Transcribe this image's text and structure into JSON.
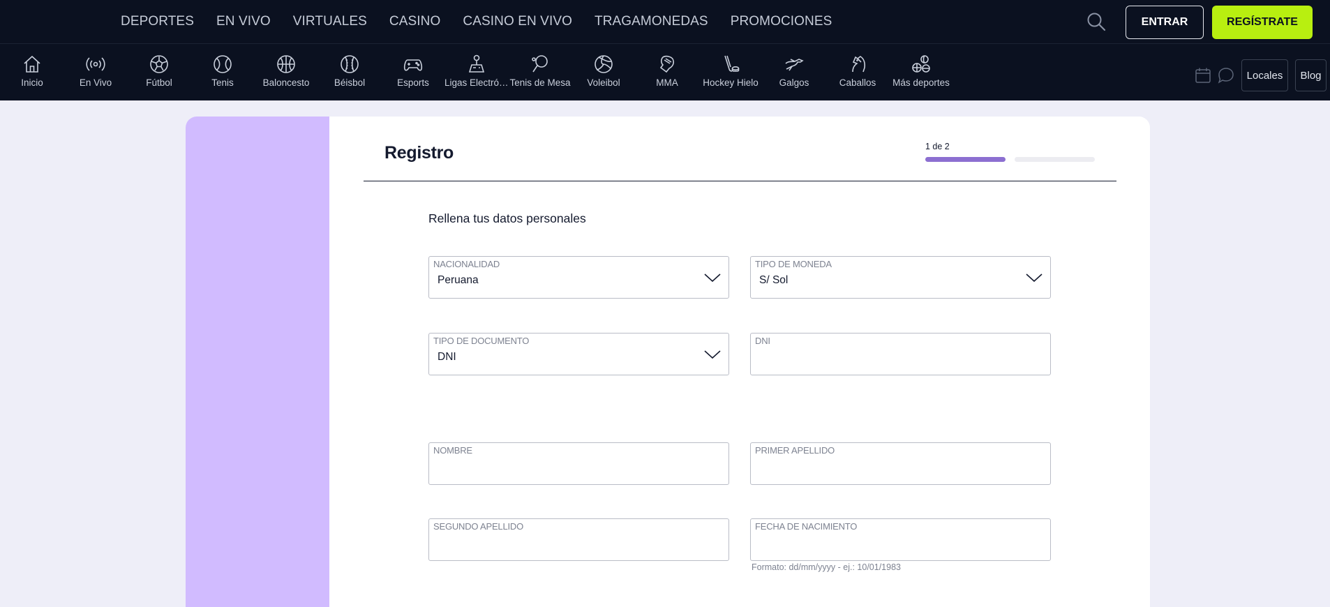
{
  "topnav": {
    "items": [
      "DEPORTES",
      "EN VIVO",
      "VIRTUALES",
      "CASINO",
      "CASINO EN VIVO",
      "TRAGAMONEDAS",
      "PROMOCIONES"
    ],
    "search_icon": "search-icon",
    "login_label": "ENTRAR",
    "register_label": "REGÍSTRATE"
  },
  "sportsbar": {
    "items": [
      {
        "label": "Inicio",
        "icon": "home-icon"
      },
      {
        "label": "En Vivo",
        "icon": "live-broadcast-icon"
      },
      {
        "label": "Fútbol",
        "icon": "soccer-ball-icon"
      },
      {
        "label": "Tenis",
        "icon": "tennis-ball-icon"
      },
      {
        "label": "Baloncesto",
        "icon": "basketball-icon"
      },
      {
        "label": "Béisbol",
        "icon": "baseball-icon"
      },
      {
        "label": "Esports",
        "icon": "gamepad-icon"
      },
      {
        "label": "Ligas Electrónicas",
        "icon": "joystick-icon"
      },
      {
        "label": "Tenis de Mesa",
        "icon": "ping-pong-icon"
      },
      {
        "label": "Voleibol",
        "icon": "volleyball-icon"
      },
      {
        "label": "MMA",
        "icon": "boxing-glove-icon"
      },
      {
        "label": "Hockey Hielo",
        "icon": "hockey-icon"
      },
      {
        "label": "Galgos",
        "icon": "greyhound-icon"
      },
      {
        "label": "Caballos",
        "icon": "horse-icon"
      },
      {
        "label": "Más deportes",
        "icon": "more-sports-icon"
      }
    ],
    "calendar_icon": "calendar-icon",
    "chat_icon": "chat-icon",
    "locales_label": "Locales",
    "blog_label": "Blog"
  },
  "form": {
    "title": "Registro",
    "step": "1 de 2",
    "step_progress": 0.5,
    "subtitle": "Rellena tus datos personales",
    "fields": {
      "nacionalidad": {
        "label": "NACIONALIDAD",
        "value": "Peruana"
      },
      "moneda": {
        "label": "TIPO DE MONEDA",
        "value": "S/ Sol"
      },
      "documento": {
        "label": "TIPO DE DOCUMENTO",
        "value": "DNI"
      },
      "dni": {
        "label": "DNI",
        "value": ""
      },
      "nombre": {
        "label": "NOMBRE",
        "value": ""
      },
      "primer_apellido": {
        "label": "PRIMER APELLIDO",
        "value": ""
      },
      "segundo_apellido": {
        "label": "SEGUNDO APELLIDO",
        "value": ""
      },
      "fecha_nacimiento": {
        "label": "FECHA DE NACIMIENTO",
        "value": ""
      }
    },
    "date_hint": "Formato: dd/mm/yyyy - ej.: 10/01/1983"
  },
  "colors": {
    "nav_bg": "#0b1120",
    "accent_green": "#b8ef10",
    "accent_purple": "#8c6fd1",
    "side_panel": "#d1bbff"
  }
}
